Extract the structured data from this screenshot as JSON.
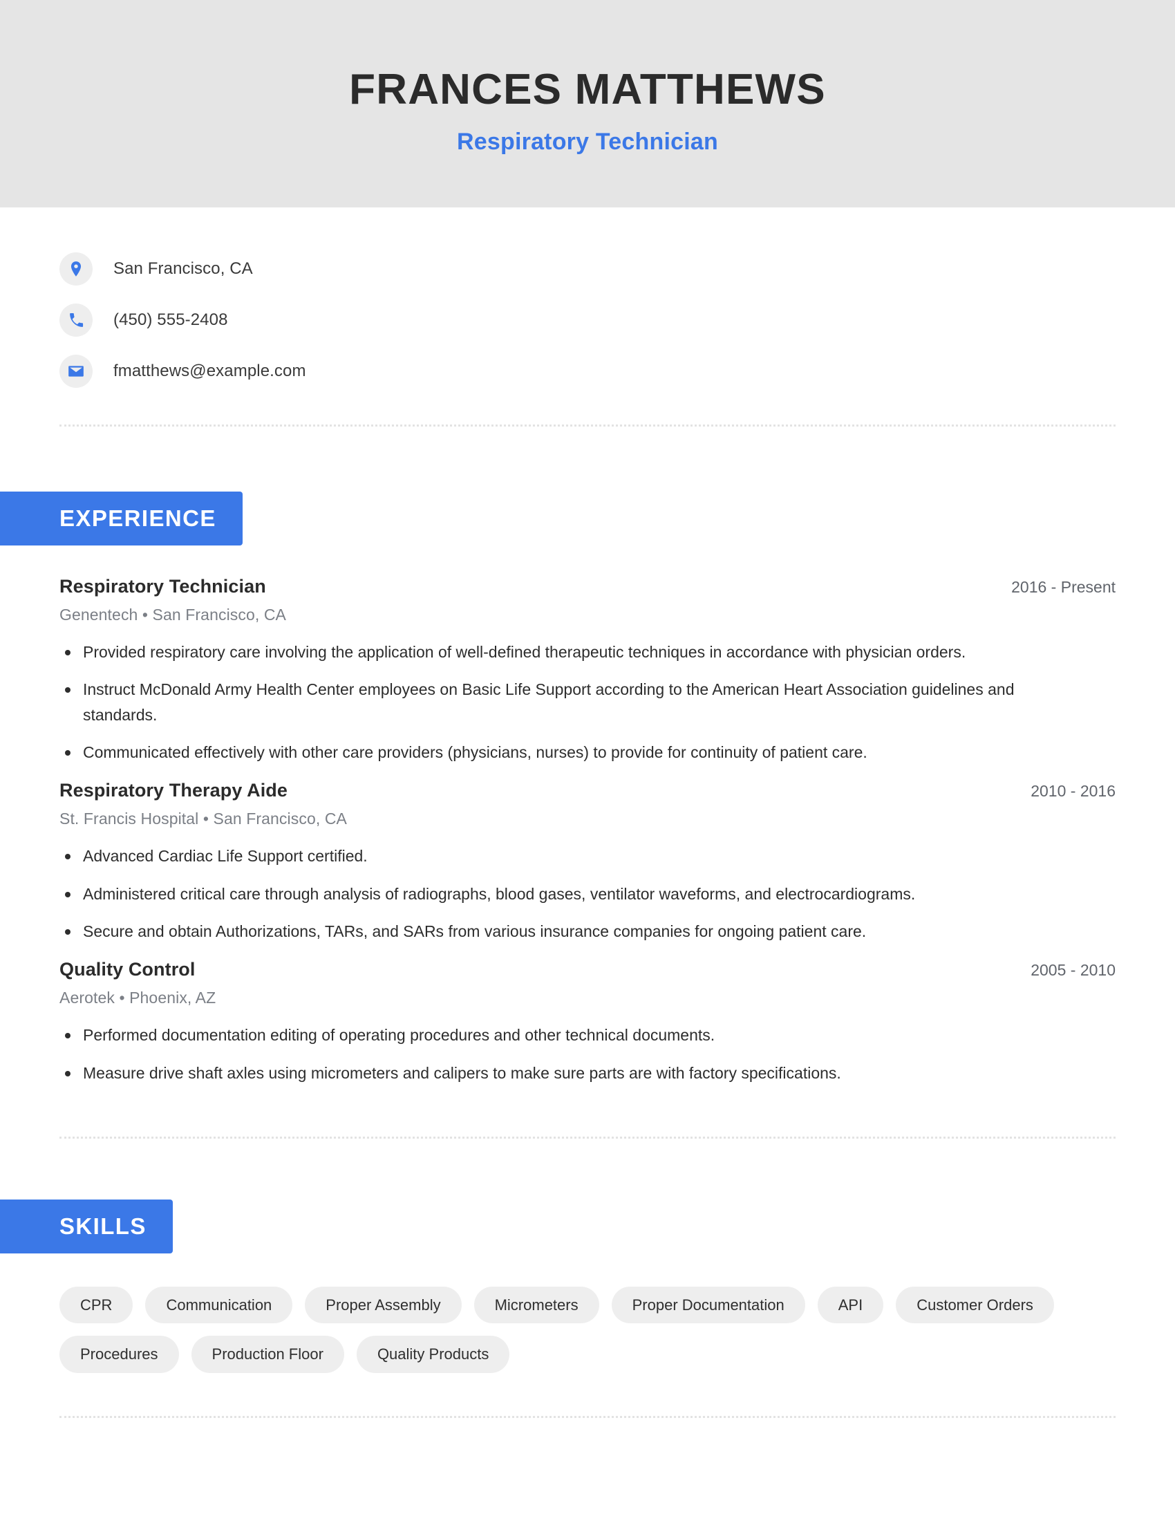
{
  "header": {
    "name": "FRANCES MATTHEWS",
    "title": "Respiratory Technician"
  },
  "theme": {
    "accent": "#3b78e7",
    "header_band": "#e5e5e5",
    "tag_bg": "#eeeeee",
    "icon_bg": "#eeeeee",
    "text": "#2d2d2d",
    "muted": "#7b7f86"
  },
  "contact": {
    "items": [
      {
        "icon": "location-pin-icon",
        "value": "San Francisco, CA"
      },
      {
        "icon": "phone-icon",
        "value": "(450) 555-2408"
      },
      {
        "icon": "email-icon",
        "value": "fmatthews@example.com"
      }
    ]
  },
  "experience": {
    "heading": "EXPERIENCE",
    "entries": [
      {
        "role": "Respiratory Technician",
        "dates": "2016 - Present",
        "company": "Genentech",
        "location": "San Francisco, CA",
        "meta": "Genentech  •  San Francisco, CA",
        "bullets": [
          "Provided respiratory care involving the application of well-defined therapeutic techniques in accordance with physician orders.",
          "Instruct McDonald Army Health Center employees on Basic Life Support according to the American Heart Association guidelines and standards.",
          "Communicated effectively with other care providers (physicians, nurses) to provide for continuity of patient care."
        ]
      },
      {
        "role": "Respiratory Therapy Aide",
        "dates": "2010 - 2016",
        "company": "St. Francis Hospital",
        "location": "San Francisco, CA",
        "meta": "St. Francis Hospital  •  San Francisco, CA",
        "bullets": [
          "Advanced Cardiac Life Support certified.",
          "Administered critical care through analysis of radiographs, blood gases, ventilator waveforms, and electrocardiograms.",
          "Secure and obtain Authorizations, TARs, and SARs from various insurance companies for ongoing patient care."
        ]
      },
      {
        "role": "Quality Control",
        "dates": "2005 - 2010",
        "company": "Aerotek",
        "location": "Phoenix, AZ",
        "meta": "Aerotek  •  Phoenix, AZ",
        "bullets": [
          "Performed documentation editing of operating procedures and other technical documents.",
          "Measure drive shaft axles using micrometers and calipers to make sure parts are with factory specifications."
        ]
      }
    ]
  },
  "skills": {
    "heading": "SKILLS",
    "tags": [
      "CPR",
      "Communication",
      "Proper Assembly",
      "Micrometers",
      "Proper Documentation",
      "API",
      "Customer Orders",
      "Procedures",
      "Production Floor",
      "Quality Products"
    ]
  }
}
